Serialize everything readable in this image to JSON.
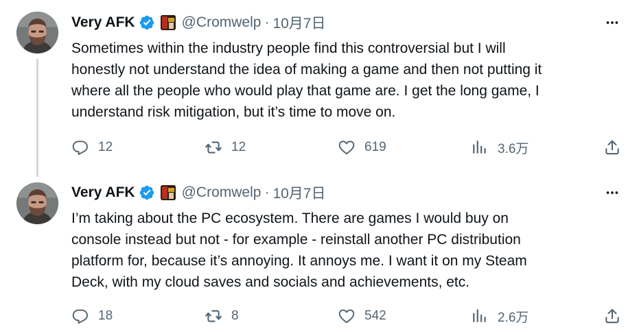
{
  "tweets": [
    {
      "name": "Very AFK",
      "handle": "@Cromwelp",
      "separator": "·",
      "date": "10月7日",
      "text": "Sometimes within the industry people find this controversial but I will\nhonestly not understand the idea of making a game and then not putting it\nwhere all the people who would play that game are. I get the long game, I\nunderstand risk mitigation, but it’s time to move on.",
      "replies": "12",
      "retweets": "12",
      "likes": "619",
      "views": "3.6万"
    },
    {
      "name": "Very AFK",
      "handle": "@Cromwelp",
      "separator": "·",
      "date": "10月7日",
      "text": "I’m taking about the PC ecosystem. There are games I would buy on\nconsole instead but not - for example - reinstall another PC distribution\nplatform for, because it’s annoying. It annoys me. I want it on my Steam\nDeck, with my cloud saves and socials and achievements, etc.",
      "replies": "18",
      "retweets": "8",
      "likes": "542",
      "views": "2.6万"
    }
  ],
  "colors": {
    "text": "#0f1419",
    "secondary": "#536471",
    "verified": "#1d9bf0",
    "thread_line": "#cfd9de"
  },
  "icons": [
    "verified-badge-icon",
    "affiliate-badge-icon",
    "more-icon",
    "reply-icon",
    "retweet-icon",
    "like-icon",
    "views-icon",
    "share-icon"
  ]
}
